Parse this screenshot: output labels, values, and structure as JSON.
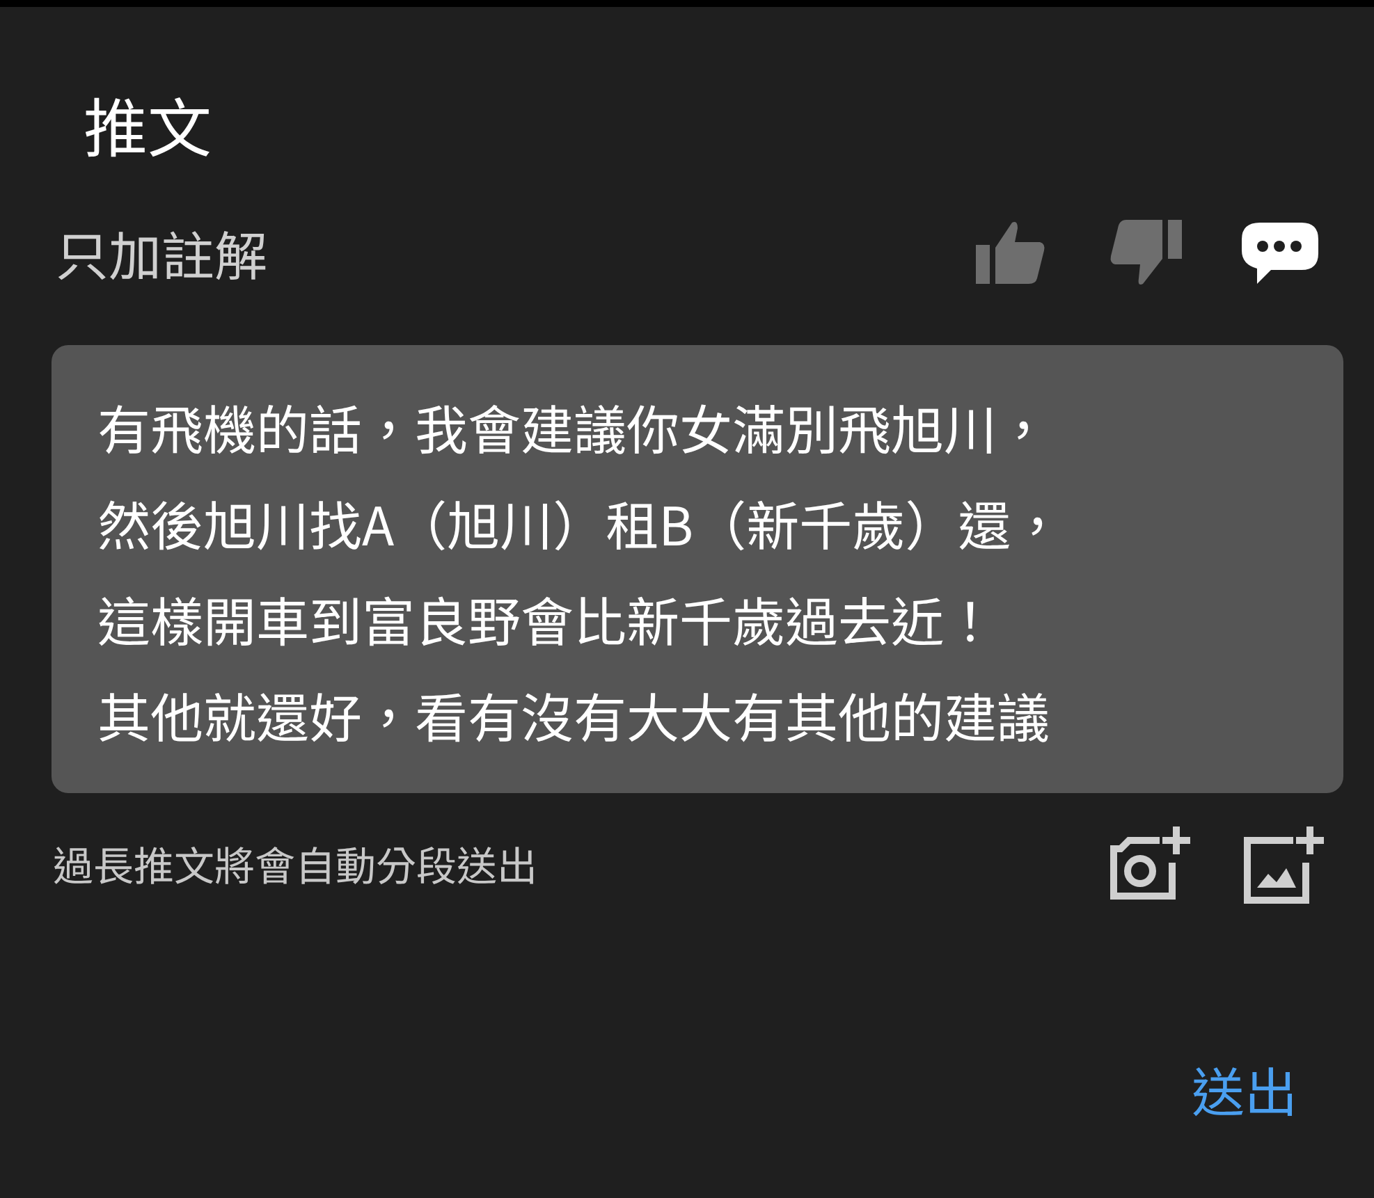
{
  "title": "推文",
  "mode": {
    "label": "只加註解"
  },
  "reactions": [
    {
      "kind": "like",
      "selected": false
    },
    {
      "kind": "dislike",
      "selected": false
    },
    {
      "kind": "comment",
      "selected": true
    }
  ],
  "input": {
    "value_lines": [
      "有飛機的話，我會建議你女滿別飛旭川，",
      "然後旭川找A（旭川）租B（新千歲）還，",
      "這樣開車到富良野會比新千歲過去近！",
      "其他就還好，看有沒有大大有其他的建議"
    ]
  },
  "hint": "過長推文將會自動分段送出",
  "attachments": [
    {
      "kind": "camera"
    },
    {
      "kind": "image"
    }
  ],
  "submit": "送出"
}
